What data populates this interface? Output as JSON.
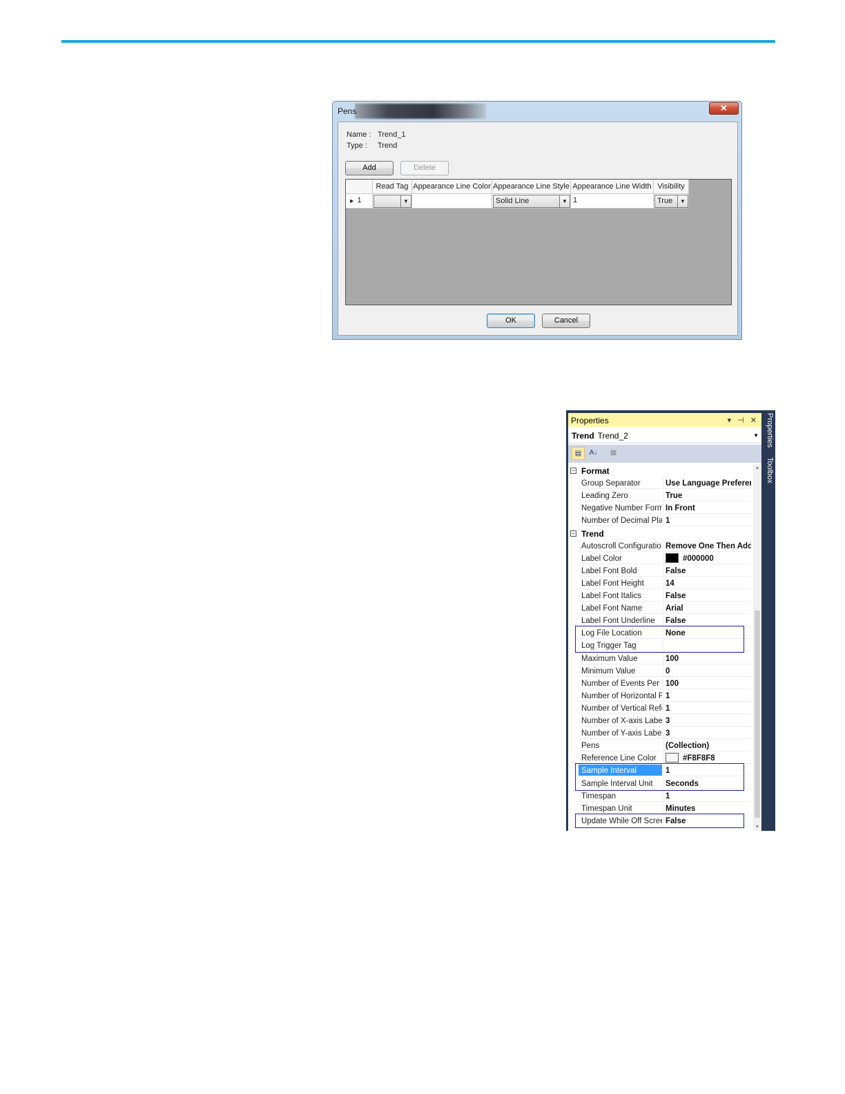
{
  "dialog": {
    "title": "Pens",
    "close_glyph": "✕",
    "name_label": "Name :",
    "name_value": "Trend_1",
    "type_label": "Type :",
    "type_value": "Trend",
    "add_label": "Add",
    "delete_label": "Delete",
    "ok_label": "OK",
    "cancel_label": "Cancel",
    "columns": [
      "Read Tag",
      "Appearance Line Color",
      "Appearance Line Style",
      "Appearance Line Width",
      "Visibility"
    ],
    "row": {
      "indicator": "1",
      "read_tag": "",
      "line_color": "",
      "line_style": "Solid Line",
      "line_width": "1",
      "visibility": "True"
    }
  },
  "properties": {
    "title": "Properties",
    "title_icons": "▾ ⊣ ✕",
    "object_type": "Trend",
    "object_name": "Trend_2",
    "side_tabs": [
      "Properties",
      "Toolbox"
    ],
    "categories": [
      {
        "name": "Format",
        "rows": [
          {
            "name": "Group Separator",
            "value": "Use Language Preferen"
          },
          {
            "name": "Leading Zero",
            "value": "True"
          },
          {
            "name": "Negative Number Form",
            "value": "In Front"
          },
          {
            "name": "Number of Decimal Pla",
            "value": "1"
          }
        ]
      },
      {
        "name": "Trend",
        "rows": [
          {
            "name": "Autoscroll Configuratio",
            "value": "Remove One Then Add"
          },
          {
            "name": "Label Color",
            "value": "#000000",
            "swatch": "#000000"
          },
          {
            "name": "Label Font Bold",
            "value": "False"
          },
          {
            "name": "Label Font Height",
            "value": "14"
          },
          {
            "name": "Label Font Italics",
            "value": "False"
          },
          {
            "name": "Label Font Name",
            "value": "Arial"
          },
          {
            "name": "Label Font Underline",
            "value": "False"
          },
          {
            "name": "Log File Location",
            "value": "None"
          },
          {
            "name": "Log Trigger Tag",
            "value": ""
          },
          {
            "name": "Maximum Value",
            "value": "100"
          },
          {
            "name": "Minimum Value",
            "value": "0"
          },
          {
            "name": "Number of Events Per F",
            "value": "100"
          },
          {
            "name": "Number of Horizontal F",
            "value": "1"
          },
          {
            "name": "Number of Vertical Refe",
            "value": "1"
          },
          {
            "name": "Number of X-axis Label",
            "value": "3"
          },
          {
            "name": "Number of Y-axis Label",
            "value": "3"
          },
          {
            "name": "Pens",
            "value": "(Collection)"
          },
          {
            "name": "Reference Line Color",
            "value": "#F8F8F8",
            "swatch": "#F8F8F8"
          },
          {
            "name": "Sample Interval",
            "value": "1",
            "selected": true
          },
          {
            "name": "Sample Interval Unit",
            "value": "Seconds"
          },
          {
            "name": "Timespan",
            "value": "1"
          },
          {
            "name": "Timespan Unit",
            "value": "Minutes"
          },
          {
            "name": "Update While Off Scree",
            "value": "False"
          }
        ]
      }
    ]
  },
  "colors": {
    "rule": "#1ba6e0",
    "highlight_box": "#1f1fa8",
    "selection": "#3399ff",
    "panel_frame": "#293955"
  }
}
